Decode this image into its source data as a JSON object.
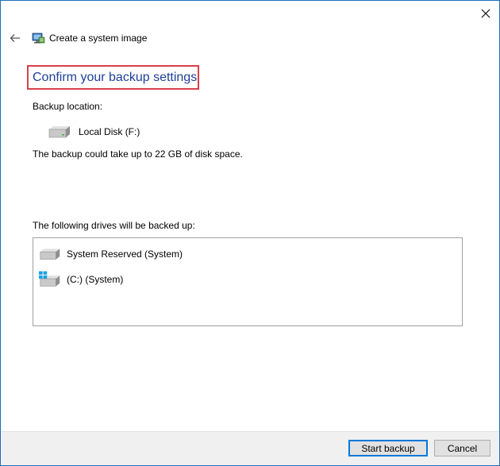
{
  "window": {
    "title": "Create a system image",
    "accent_color": "#1c6fb8"
  },
  "icons": {
    "close": "close-icon",
    "back": "back-arrow-icon",
    "app": "system-image-icon",
    "disk": "disk-drive-icon",
    "windows": "windows-logo-icon"
  },
  "main": {
    "heading": "Confirm your backup settings",
    "heading_color": "#1e3f99",
    "highlight_color": "#d9404a",
    "backup_location_label": "Backup location:",
    "backup_location": "Local Disk (F:)",
    "space_note": "The backup could take up to 22 GB of disk space.",
    "drives_label": "The following drives will be backed up:",
    "drives": [
      {
        "label": "System Reserved (System)",
        "icon": "disk-drive-icon"
      },
      {
        "label": "(C:) (System)",
        "icon": "windows-disk-drive-icon"
      }
    ]
  },
  "footer": {
    "start_button": "Start backup",
    "cancel_button": "Cancel"
  }
}
